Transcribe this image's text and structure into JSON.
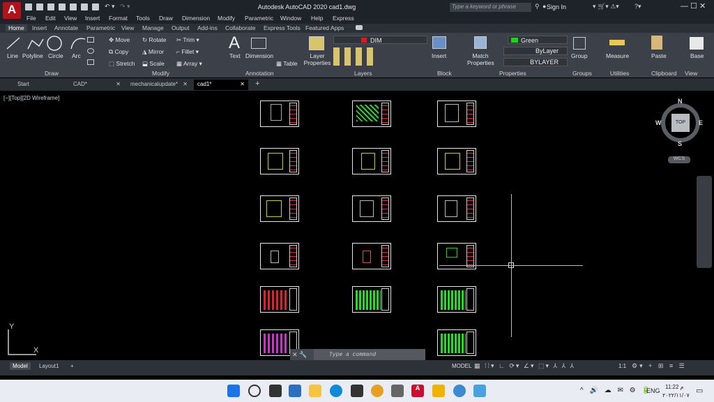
{
  "app": {
    "title": "Autodesk AutoCAD 2020    cad1.dwg",
    "search_placeholder": "Type a keyword or phrase",
    "sign_in": "Sign In"
  },
  "menu": [
    "File",
    "Edit",
    "View",
    "Insert",
    "Format",
    "Tools",
    "Draw",
    "Dimension",
    "Modify",
    "Parametric",
    "Window",
    "Help",
    "Express"
  ],
  "ribbon_tabs": [
    "Home",
    "Insert",
    "Annotate",
    "Parametric",
    "View",
    "Manage",
    "Output",
    "Add-ins",
    "Collaborate",
    "Express Tools",
    "Featured Apps"
  ],
  "draw": {
    "line": "Line",
    "polyline": "Polyline",
    "circle": "Circle",
    "arc": "Arc",
    "title": "Draw"
  },
  "modify": {
    "move": "Move",
    "rotate": "Rotate",
    "trim": "Trim",
    "copy": "Copy",
    "mirror": "Mirror",
    "fillet": "Fillet",
    "stretch": "Stretch",
    "scale": "Scale",
    "array": "Array",
    "title": "Modify"
  },
  "annotation": {
    "text": "Text",
    "dimension": "Dimension",
    "table": "Table",
    "title": "Annotation"
  },
  "layers": {
    "properties": "Layer Properties",
    "current": "DIM",
    "title": "Layers"
  },
  "block": {
    "insert": "Insert",
    "title": "Block"
  },
  "properties": {
    "match": "Match Properties",
    "color": "Green",
    "linetype": "ByLayer",
    "lineweight": "BYLAYER",
    "title": "Properties"
  },
  "groups": {
    "group": "Group",
    "title": "Groups"
  },
  "utilities": {
    "measure": "Measure",
    "title": "Utilities"
  },
  "clipboard": {
    "paste": "Paste",
    "title": "Clipboard"
  },
  "view": {
    "base": "Base",
    "title": "View"
  },
  "doc_tabs": [
    "Start",
    "CAD*",
    "mechanicalupdate*",
    "cad1*"
  ],
  "viewport_label": "[−][Top][2D Wireframe]",
  "viewcube": {
    "n": "N",
    "s": "S",
    "e": "E",
    "w": "W",
    "top": "TOP",
    "wcs": "WCS"
  },
  "ucs": {
    "x": "X",
    "y": "Y"
  },
  "command_placeholder": "Type a command",
  "layout_tabs": [
    "Model",
    "Layout1"
  ],
  "status": {
    "model": "MODEL",
    "scale": "1:1"
  },
  "tray": {
    "lang": "ENG",
    "time": "11:22 م",
    "date": "٢٠٢٢/١١/٠٧"
  }
}
